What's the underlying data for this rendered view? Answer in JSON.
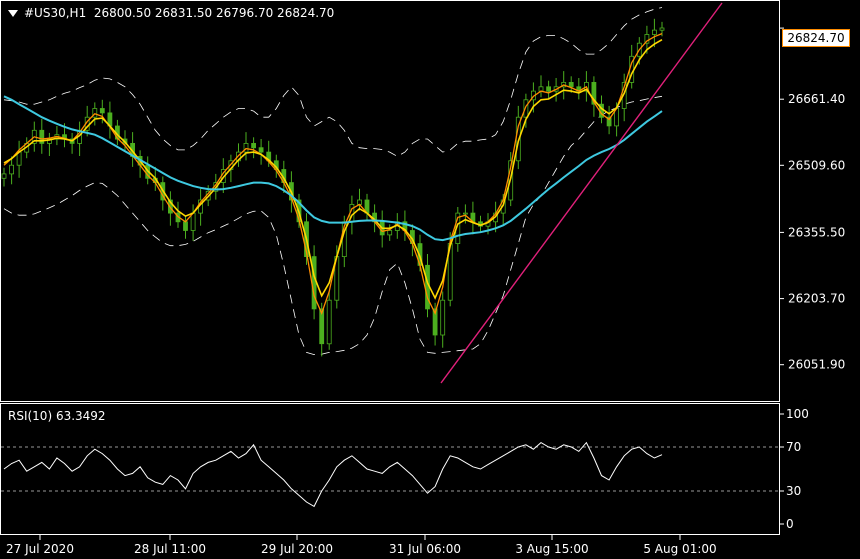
{
  "header": {
    "symbol": "#US30,H1",
    "ohlc": "26800.50 26831.50 26796.70 26824.70"
  },
  "current_price_label": "26824.70",
  "indicator": {
    "label": "RSI(10) 63.3492"
  },
  "colors": {
    "background": "#000000",
    "candles": "#4caf1f",
    "ma_fast": "#ff8c00",
    "ma_mid": "#ffd700",
    "ma_slow": "#3ec9e0",
    "bands": "#ffffff",
    "trendline": "#e0207a",
    "axes": "#ffffff",
    "rsi_line": "#ffffff"
  },
  "chart_data": [
    {
      "type": "line",
      "title": "#US30,H1",
      "x_tick_labels": [
        "27 Jul 2020",
        "28 Jul 11:00",
        "29 Jul 20:00",
        "31 Jul 06:00",
        "3 Aug 15:00",
        "5 Aug 01:00"
      ],
      "y_tick_labels": [
        "26824.70",
        "26661.40",
        "26509.60",
        "26355.50",
        "26203.70",
        "26051.90"
      ],
      "ylim": [
        25980,
        26880
      ],
      "grid": false,
      "series": [
        {
          "style": "candles",
          "values": [
            26490,
            26510,
            26540,
            26560,
            26590,
            26560,
            26570,
            26580,
            26570,
            26560,
            26590,
            26620,
            26640,
            26630,
            26600,
            26570,
            26560,
            26530,
            26510,
            26480,
            26470,
            26430,
            26400,
            26380,
            26360,
            26400,
            26430,
            26450,
            26470,
            26500,
            26520,
            26540,
            26560,
            26550,
            26540,
            26520,
            26500,
            26470,
            26430,
            26380,
            26300,
            26180,
            26100,
            26200,
            26300,
            26380,
            26420,
            26430,
            26400,
            26380,
            26350,
            26360,
            26380,
            26360,
            26330,
            26280,
            26180,
            26120,
            26200,
            26330,
            26400,
            26400,
            26380,
            26370,
            26380,
            26400,
            26430,
            26520,
            26620,
            26660,
            26680,
            26690,
            26680,
            26690,
            26700,
            26690,
            26680,
            26700,
            26650,
            26620,
            26600,
            26640,
            26700,
            26760,
            26790,
            26810,
            26820,
            26825
          ]
        },
        {
          "name": "",
          "style": "ma-fast",
          "values": [
            26510,
            26525,
            26545,
            26560,
            26575,
            26570,
            26572,
            26576,
            26572,
            26566,
            26585,
            26610,
            26628,
            26622,
            26598,
            26572,
            26555,
            26532,
            26510,
            26487,
            26470,
            26440,
            26412,
            26392,
            26380,
            26400,
            26425,
            26445,
            26465,
            26492,
            26512,
            26532,
            26548,
            26545,
            26535,
            26518,
            26498,
            26470,
            26435,
            26385,
            26310,
            26210,
            26170,
            26220,
            26300,
            26370,
            26410,
            26420,
            26400,
            26380,
            26358,
            26362,
            26375,
            26358,
            26330,
            26280,
            26205,
            26170,
            26230,
            26335,
            26390,
            26395,
            26380,
            26372,
            26380,
            26398,
            26430,
            26505,
            26600,
            26645,
            26668,
            26680,
            26676,
            26684,
            26694,
            26688,
            26680,
            26690,
            26655,
            26628,
            26615,
            26640,
            26690,
            26745,
            26775,
            26795,
            26805,
            26812
          ]
        },
        {
          "name": "",
          "style": "ma-mid",
          "values": [
            26515,
            26525,
            26540,
            26552,
            26566,
            26566,
            26568,
            26572,
            26570,
            26566,
            26578,
            26598,
            26616,
            26618,
            26600,
            26580,
            26563,
            26542,
            26520,
            26497,
            26480,
            26452,
            26425,
            26405,
            26393,
            26400,
            26420,
            26438,
            26458,
            26482,
            26502,
            26522,
            26538,
            26540,
            26535,
            26522,
            26505,
            26480,
            26448,
            26402,
            26340,
            26255,
            26210,
            26240,
            26300,
            26358,
            26395,
            26410,
            26400,
            26385,
            26365,
            26365,
            26372,
            26362,
            26340,
            26300,
            26240,
            26205,
            26245,
            26325,
            26375,
            26385,
            26378,
            26372,
            26378,
            26392,
            26418,
            26480,
            26565,
            26615,
            26645,
            26660,
            26662,
            26672,
            26682,
            26680,
            26676,
            26684,
            26660,
            26640,
            26628,
            26642,
            26675,
            26720,
            26752,
            26775,
            26788,
            26798
          ]
        },
        {
          "name": "",
          "style": "ma-slow",
          "values": [
            26668,
            26660,
            26650,
            26640,
            26630,
            26620,
            26612,
            26605,
            26598,
            26592,
            26588,
            26584,
            26580,
            26572,
            26562,
            26552,
            26542,
            26532,
            26522,
            26512,
            26502,
            26492,
            26482,
            26474,
            26468,
            26462,
            26458,
            26455,
            26454,
            26455,
            26458,
            26462,
            26466,
            26470,
            26470,
            26468,
            26462,
            26452,
            26440,
            26424,
            26406,
            26390,
            26382,
            26378,
            26378,
            26378,
            26380,
            26382,
            26383,
            26383,
            26382,
            26380,
            26378,
            26375,
            26370,
            26362,
            26350,
            26340,
            26338,
            26342,
            26348,
            26352,
            26354,
            26356,
            26360,
            26365,
            26372,
            26382,
            26396,
            26410,
            26425,
            26440,
            26455,
            26468,
            26482,
            26495,
            26508,
            26522,
            26532,
            26540,
            26547,
            26556,
            26568,
            26582,
            26596,
            26610,
            26622,
            26634
          ]
        },
        {
          "name": "",
          "style": "band-upper",
          "values": [
            26660,
            26658,
            26655,
            26650,
            26650,
            26655,
            26660,
            26668,
            26675,
            26680,
            26688,
            26695,
            26705,
            26710,
            26708,
            26700,
            26690,
            26672,
            26650,
            26620,
            26590,
            26570,
            26555,
            26545,
            26545,
            26555,
            26570,
            26590,
            26605,
            26620,
            26632,
            26640,
            26640,
            26634,
            26620,
            26620,
            26640,
            26670,
            26690,
            26670,
            26620,
            26600,
            26610,
            26620,
            26610,
            26590,
            26560,
            26550,
            26548,
            26548,
            26546,
            26540,
            26530,
            26540,
            26560,
            26570,
            26570,
            26555,
            26540,
            26545,
            26560,
            26565,
            26565,
            26568,
            26570,
            26580,
            26610,
            26660,
            26720,
            26770,
            26795,
            26805,
            26808,
            26808,
            26800,
            26790,
            26775,
            26765,
            26765,
            26775,
            26790,
            26810,
            26830,
            26845,
            26855,
            26862,
            26868,
            26872
          ]
        },
        {
          "name": "",
          "style": "band-lower",
          "values": [
            26410,
            26400,
            26395,
            26395,
            26398,
            26405,
            26412,
            26420,
            26430,
            26440,
            26452,
            26462,
            26470,
            26468,
            26455,
            26440,
            26420,
            26400,
            26380,
            26360,
            26345,
            26332,
            26325,
            26325,
            26328,
            26335,
            26345,
            26355,
            26362,
            26370,
            26378,
            26388,
            26398,
            26404,
            26405,
            26390,
            26350,
            26280,
            26200,
            26120,
            26080,
            26075,
            26076,
            26080,
            26082,
            26085,
            26090,
            26100,
            26120,
            26160,
            26220,
            26270,
            26285,
            26240,
            26180,
            26110,
            26080,
            26078,
            26080,
            26082,
            26084,
            26086,
            26088,
            26100,
            26130,
            26170,
            26210,
            26270,
            26330,
            26390,
            26420,
            26440,
            26470,
            26500,
            26530,
            26555,
            26570,
            26590,
            26610,
            26625,
            26635,
            26642,
            26650,
            26655,
            26658,
            26662,
            26665,
            26668
          ]
        }
      ]
    },
    {
      "type": "line",
      "title": "RSI(10) 63.3492",
      "y_tick_labels": [
        "100",
        "70",
        "30",
        "0"
      ],
      "ylim": [
        0,
        100
      ],
      "levels": [
        70,
        30
      ],
      "grid": false,
      "series": [
        {
          "name": "RSI(10)",
          "values": [
            50,
            55,
            58,
            48,
            52,
            56,
            50,
            60,
            55,
            48,
            52,
            62,
            68,
            64,
            58,
            50,
            44,
            46,
            52,
            42,
            38,
            36,
            44,
            40,
            32,
            46,
            52,
            56,
            58,
            62,
            66,
            60,
            64,
            72,
            58,
            52,
            46,
            40,
            32,
            26,
            20,
            16,
            30,
            40,
            52,
            58,
            62,
            56,
            50,
            48,
            46,
            52,
            56,
            50,
            44,
            36,
            28,
            34,
            50,
            62,
            60,
            56,
            52,
            50,
            54,
            58,
            62,
            66,
            70,
            72,
            68,
            74,
            70,
            68,
            72,
            70,
            66,
            74,
            60,
            44,
            40,
            52,
            62,
            68,
            70,
            64,
            60,
            63
          ]
        }
      ]
    }
  ]
}
